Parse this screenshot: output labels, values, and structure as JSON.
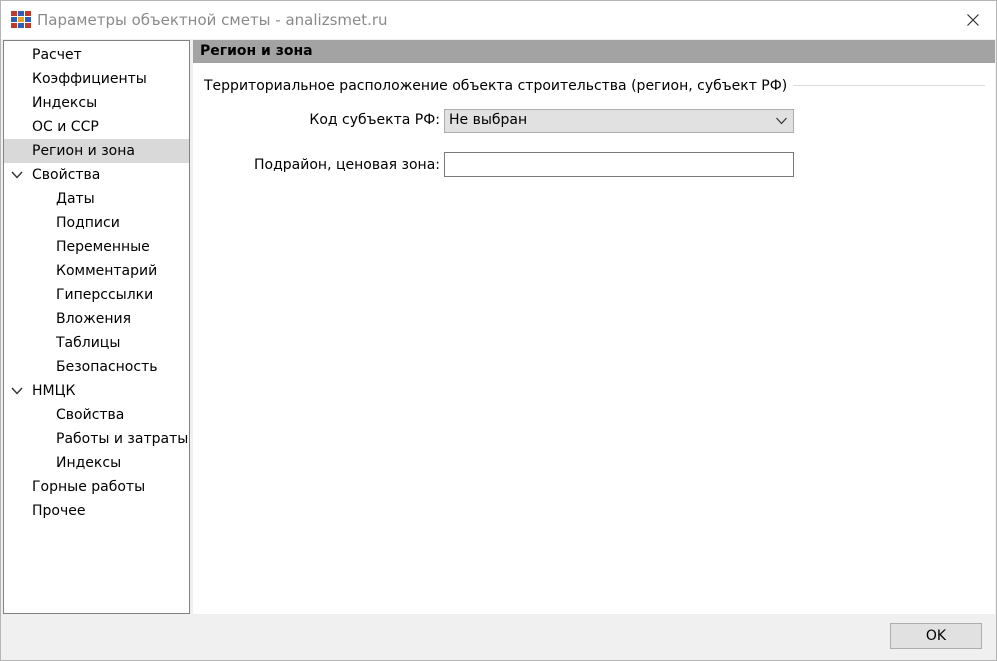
{
  "window": {
    "title": "Параметры объектной сметы - analizsmet.ru"
  },
  "nav": {
    "items": [
      {
        "label": "Расчет",
        "level": 0
      },
      {
        "label": "Коэффициенты",
        "level": 0
      },
      {
        "label": "Индексы",
        "level": 0
      },
      {
        "label": "ОС и ССР",
        "level": 0
      },
      {
        "label": "Регион и зона",
        "level": 0,
        "selected": true
      },
      {
        "label": "Свойства",
        "level": 0,
        "expanded": true
      },
      {
        "label": "Даты",
        "level": 1
      },
      {
        "label": "Подписи",
        "level": 1
      },
      {
        "label": "Переменные",
        "level": 1
      },
      {
        "label": "Комментарий",
        "level": 1
      },
      {
        "label": "Гиперссылки",
        "level": 1
      },
      {
        "label": "Вложения",
        "level": 1
      },
      {
        "label": "Таблицы",
        "level": 1
      },
      {
        "label": "Безопасность",
        "level": 1
      },
      {
        "label": "НМЦК",
        "level": 0,
        "expanded": true
      },
      {
        "label": "Свойства",
        "level": 1
      },
      {
        "label": "Работы и затраты",
        "level": 1
      },
      {
        "label": "Индексы",
        "level": 1
      },
      {
        "label": "Горные работы",
        "level": 0
      },
      {
        "label": "Прочее",
        "level": 0
      }
    ]
  },
  "content": {
    "section_title": "Регион и зона",
    "group_title": "Территориальное расположение объекта строительства (регион, субъект РФ)",
    "region_code": {
      "label": "Код субъекта РФ:",
      "value": "Не выбран"
    },
    "zone": {
      "label": "Подрайон, ценовая зона:",
      "value": ""
    }
  },
  "footer": {
    "ok_label": "OK"
  },
  "colors": {
    "selected_bg": "#d9d9d9",
    "header_bg": "#a3a3a3",
    "title_text": "#8a8a8a"
  }
}
